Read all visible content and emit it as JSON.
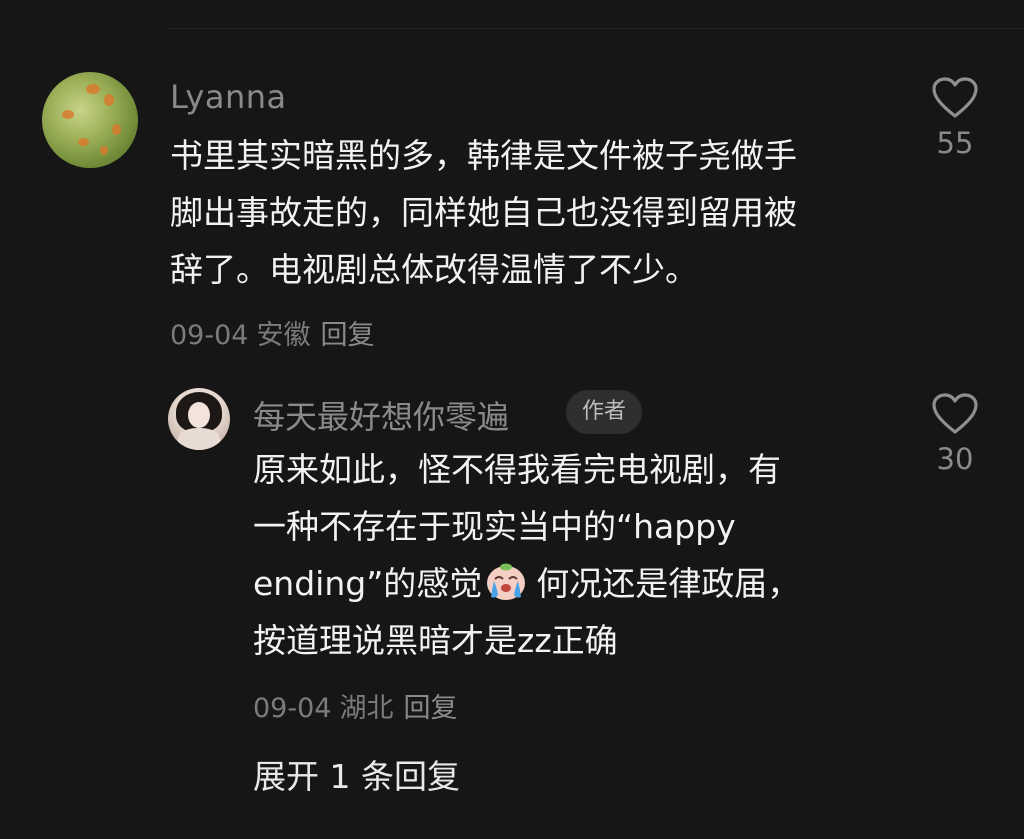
{
  "comment": {
    "username": "Lyanna",
    "lines": [
      "书里其实暗黑的多，韩律是文件被子尧做手",
      "脚出事故走的，同样她自己也没得到留用被",
      "辞了。电视剧总体改得温情了不少。"
    ],
    "date": "09-04",
    "location": "安徽",
    "reply_label": "回复",
    "likes": "55",
    "avatar_icon": "autumn-leaves-avatar"
  },
  "reply": {
    "username": "每天最好想你零遍",
    "badge": "作者",
    "lines": [
      "原来如此，怪不得我看完电视剧，有",
      "一种不存在于现实当中的“happy"
    ],
    "line3_before_emoji": "ending”的感觉",
    "emoji_icon": "crying-face-emoji",
    "line3_after_emoji": "何况还是律政届，",
    "line4": "按道理说黑暗才是zz正确",
    "date": "09-04",
    "location": "湖北",
    "reply_label": "回复",
    "likes": "30",
    "avatar_icon": "woman-portrait-avatar"
  },
  "expand_label": "展开 1 条回复",
  "colors": {
    "background": "#161616",
    "primary_text": "#f2f2f2",
    "secondary_text": "#8a8a8a",
    "badge_bg": "#2f2f2f"
  }
}
